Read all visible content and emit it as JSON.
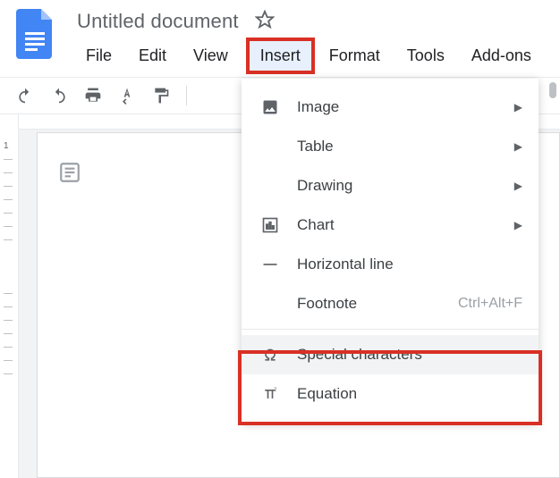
{
  "doc": {
    "title": "Untitled document"
  },
  "menubar": {
    "file": "File",
    "edit": "Edit",
    "view": "View",
    "insert": "Insert",
    "format": "Format",
    "tools": "Tools",
    "addons": "Add-ons"
  },
  "insert_menu": {
    "image": "Image",
    "table": "Table",
    "drawing": "Drawing",
    "chart": "Chart",
    "hline": "Horizontal line",
    "footnote": "Footnote",
    "footnote_shortcut": "Ctrl+Alt+F",
    "special": "Special characters",
    "equation": "Equation"
  }
}
